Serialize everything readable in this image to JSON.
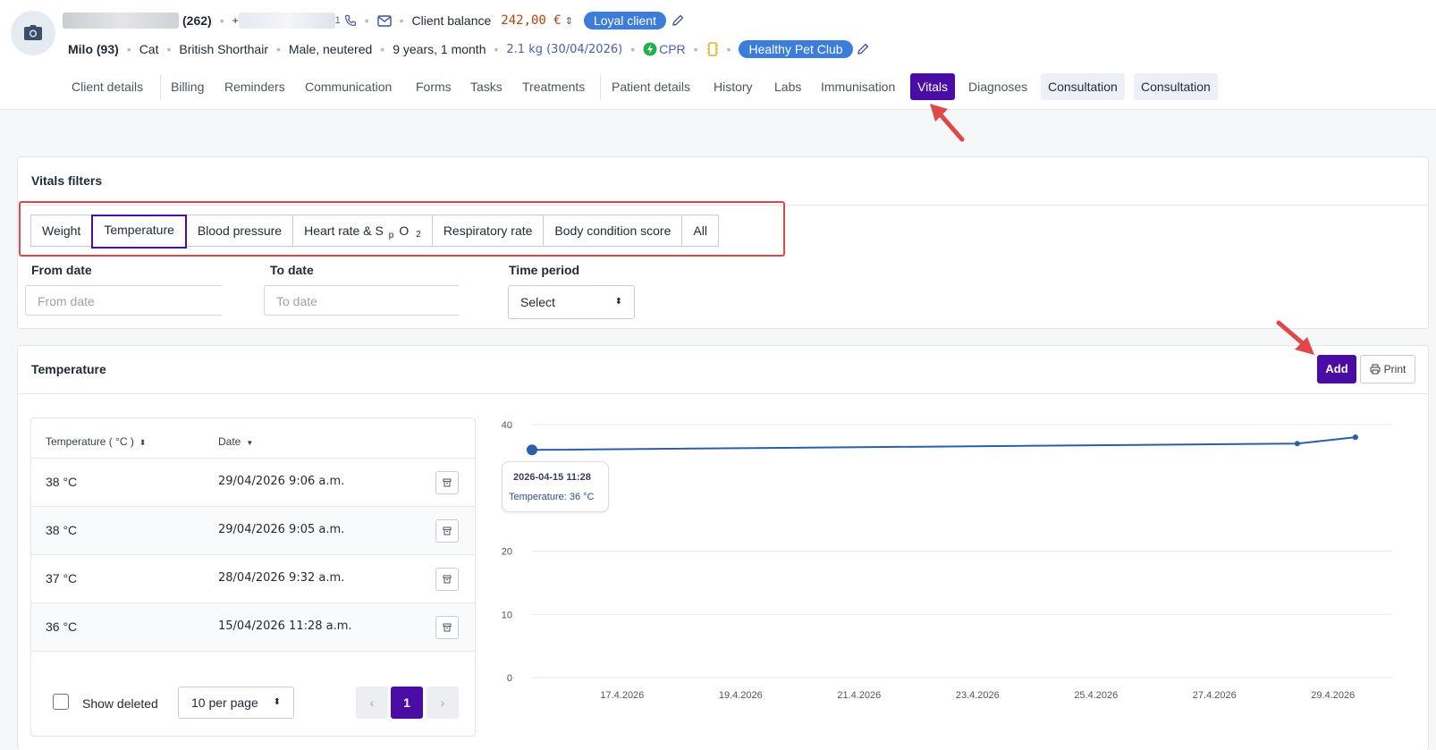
{
  "header": {
    "client_suffix": "(262)",
    "phone_prefix": "+",
    "phone_tail": "1",
    "client_balance_label": "Client balance",
    "client_balance_value": "242,00 €",
    "loyal_badge": "Loyal client",
    "pet_name": "Milo (93)",
    "species": "Cat",
    "breed": "British Shorthair",
    "sex": "Male, neutered",
    "age": "9 years, 1 month",
    "weight": "2.1 kg (30/04/2026)",
    "cpr": "CPR",
    "club_badge": "Healthy Pet Club"
  },
  "tabs": [
    {
      "label": "Client details"
    },
    {
      "label": "Billing"
    },
    {
      "label": "Reminders"
    },
    {
      "label": "Communication"
    },
    {
      "label": "Forms"
    },
    {
      "label": "Tasks"
    },
    {
      "label": "Treatments"
    },
    {
      "label": "Patient details"
    },
    {
      "label": "History"
    },
    {
      "label": "Labs"
    },
    {
      "label": "Immunisation"
    },
    {
      "label": "Vitals"
    },
    {
      "label": "Diagnoses"
    },
    {
      "label": "Consultation"
    },
    {
      "label": "Consultation"
    }
  ],
  "active_tab": "Vitals",
  "vitals_filters": {
    "title": "Vitals filters",
    "buttons": [
      "Weight",
      "Temperature",
      "Blood pressure",
      "Heart rate & S",
      "Respiratory rate",
      "Body condition score",
      "All"
    ],
    "spo2_sub_p": "p",
    "spo2_o": "O",
    "spo2_sub_2": "2",
    "selected": "Temperature",
    "from_date_label": "From date",
    "from_date_placeholder": "From date",
    "to_date_label": "To date",
    "to_date_placeholder": "To date",
    "time_period_label": "Time period",
    "time_period_value": "Select"
  },
  "temperature_panel": {
    "title": "Temperature",
    "add_label": "Add",
    "print_label": "Print",
    "col_temperature": "Temperature ( °C )",
    "col_date": "Date",
    "rows": [
      {
        "temp": "38 °C",
        "date": "29/04/2026 9:06 a.m."
      },
      {
        "temp": "38 °C",
        "date": "29/04/2026 9:05 a.m."
      },
      {
        "temp": "37 °C",
        "date": "28/04/2026 9:32 a.m."
      },
      {
        "temp": "36 °C",
        "date": "15/04/2026 11:28 a.m."
      }
    ],
    "show_deleted_label": "Show deleted",
    "per_page": "10 per page",
    "current_page": "1"
  },
  "tooltip": {
    "title": "2026-04-15 11:28",
    "body": "Temperature: 36 °C"
  },
  "colors": {
    "accent": "#4b0ca5",
    "badge": "#3b7dd8",
    "line": "#2c5fa3",
    "annotation": "#e04848",
    "balance": "#b7410e"
  },
  "chart_data": {
    "type": "line",
    "title": "",
    "xlabel": "",
    "ylabel": "",
    "ylim": [
      0,
      40
    ],
    "yticks": [
      "0",
      "10",
      "20",
      "40"
    ],
    "xticks": [
      "17.4.2026",
      "19.4.2026",
      "21.4.2026",
      "23.4.2026",
      "25.4.2026",
      "27.4.2026",
      "29.4.2026"
    ],
    "series": [
      {
        "points": [
          {
            "x": "2026-04-15 11:28",
            "y": 36
          },
          {
            "x": "2026-04-28 09:32",
            "y": 37
          },
          {
            "x": "2026-04-29 09:05",
            "y": 38
          },
          {
            "x": "2026-04-29 09:06",
            "y": 38
          }
        ]
      }
    ],
    "grid": true
  }
}
